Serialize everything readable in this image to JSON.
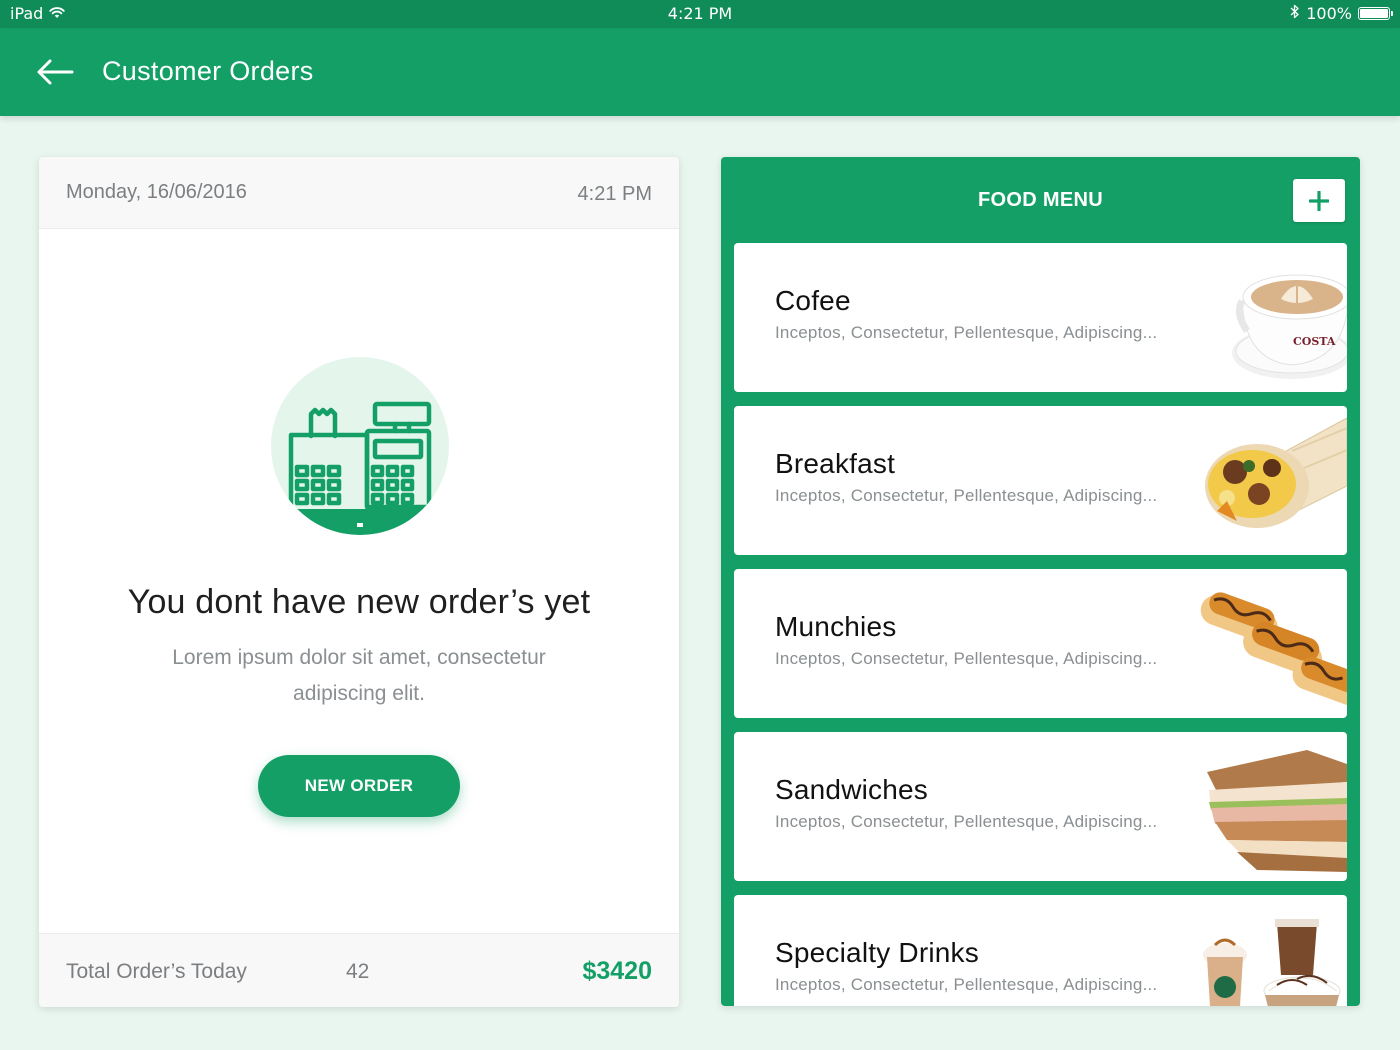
{
  "status_bar": {
    "device": "iPad",
    "time": "4:21 PM",
    "battery": "100%",
    "battery_level": 1.0,
    "icons": [
      "wifi-icon",
      "bluetooth-icon",
      "battery-icon"
    ]
  },
  "app_bar": {
    "back_icon": "arrow-left-icon",
    "title": "Customer Orders"
  },
  "order_card": {
    "date": "Monday, 16/06/2016",
    "time": "4:21 PM",
    "illustration": "cash-register-icon",
    "empty_title": "You dont have new order’s yet",
    "empty_subtitle": "Lorem ipsum dolor sit amet, consectetur adipiscing elit.",
    "new_order_label": "NEW ORDER",
    "footer": {
      "label": "Total Order’s Today",
      "count": "42",
      "total": "$3420"
    }
  },
  "food_menu": {
    "title": "FOOD MENU",
    "add_icon": "plus-icon",
    "items": [
      {
        "name": "Cofee",
        "description": "Inceptos, Consectetur, Pellentesque, Adipiscing...",
        "image": "coffee-cup-image",
        "cup_text": "COSTA"
      },
      {
        "name": "Breakfast",
        "description": "Inceptos, Consectetur, Pellentesque, Adipiscing...",
        "image": "breakfast-wrap-image"
      },
      {
        "name": "Munchies",
        "description": "Inceptos, Consectetur, Pellentesque, Adipiscing...",
        "image": "hot-dogs-image"
      },
      {
        "name": "Sandwiches",
        "description": "Inceptos, Consectetur, Pellentesque, Adipiscing...",
        "image": "sandwich-image"
      },
      {
        "name": "Specialty Drinks",
        "description": "Inceptos, Consectetur, Pellentesque, Adipiscing...",
        "image": "specialty-drinks-image"
      }
    ]
  },
  "colors": {
    "primary": "#149f66",
    "status_bar": "#108c59",
    "background": "#e9f6ef",
    "illustration_bg": "#e4f5ec",
    "muted_text": "#8a8f92"
  }
}
